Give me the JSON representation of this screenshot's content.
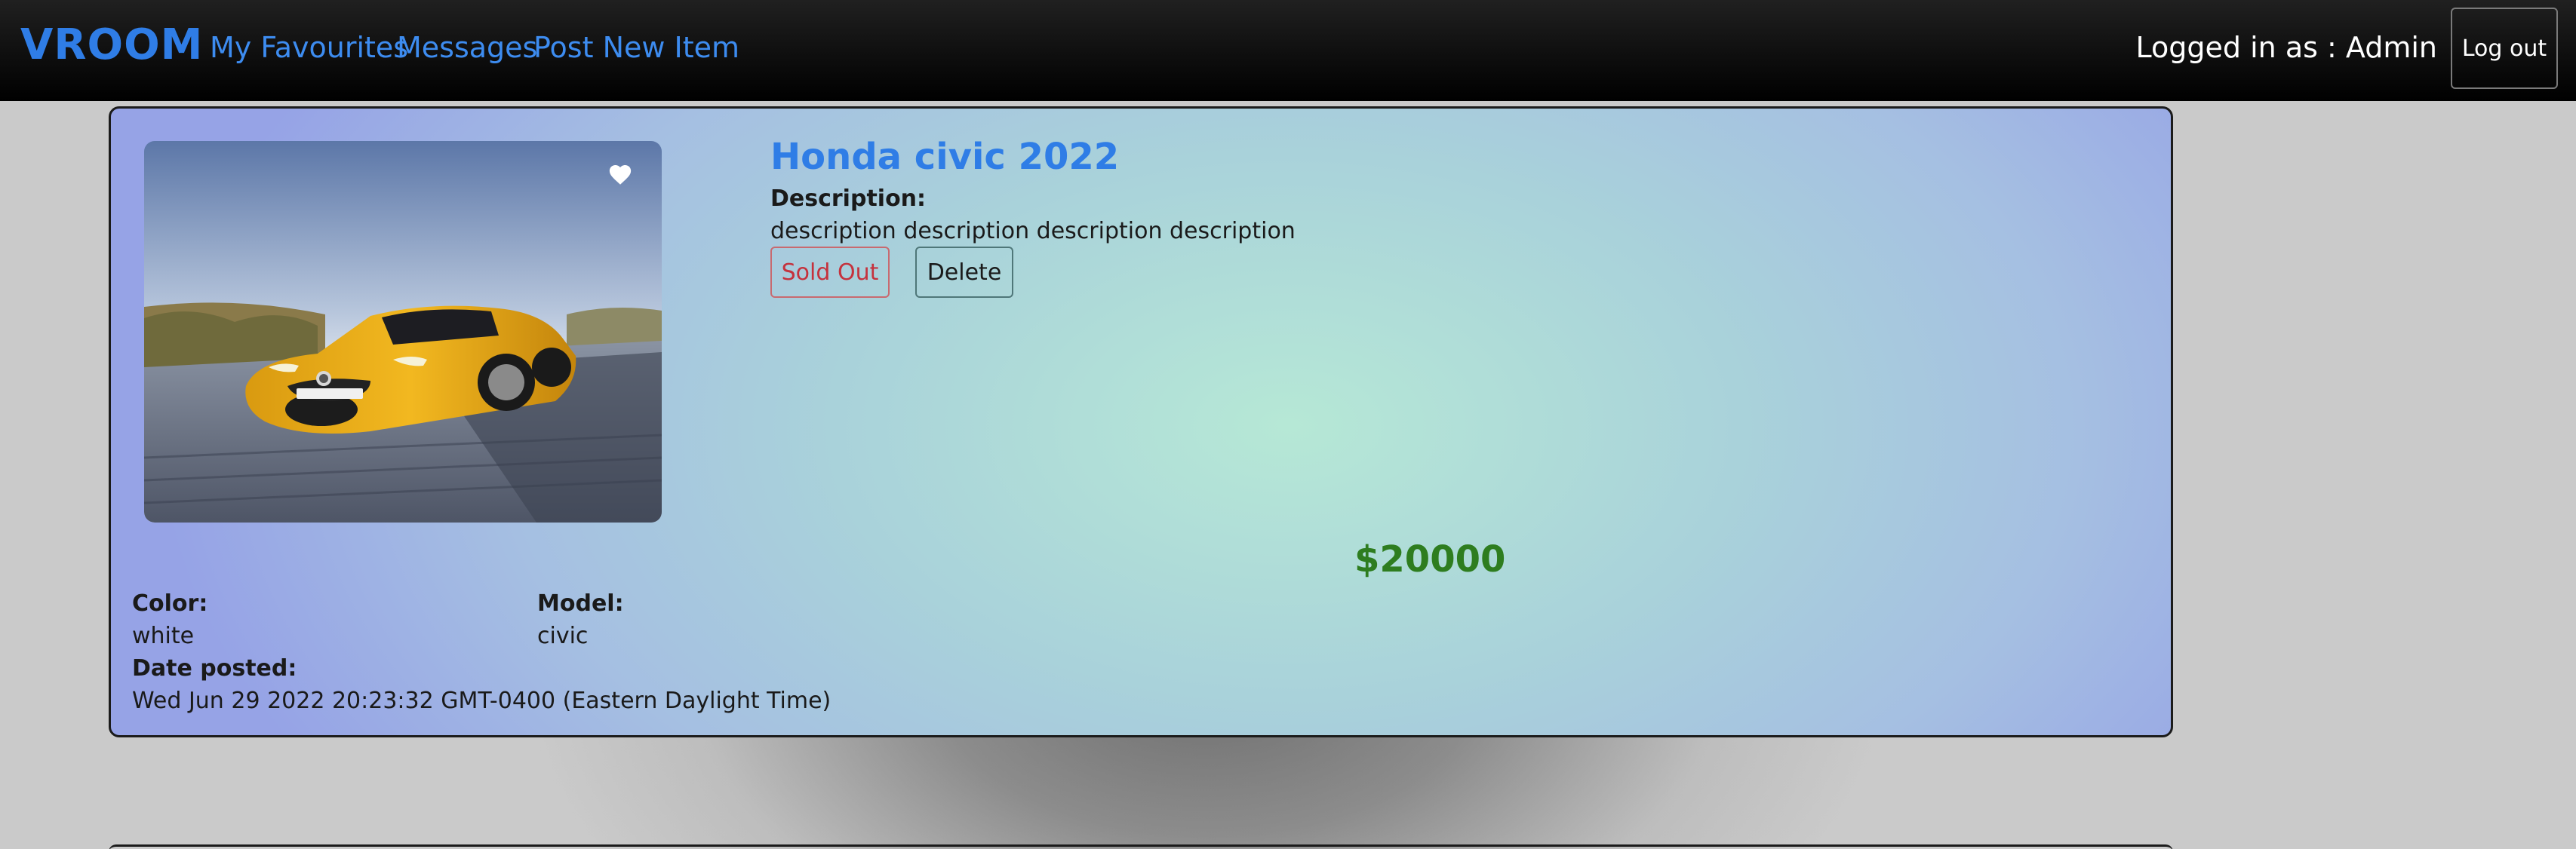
{
  "navbar": {
    "brand": "VROOM",
    "links": [
      "My Favourites",
      "Messages",
      "Post New Item"
    ],
    "logged_in_text": "Logged in as : Admin",
    "logout_label": "Log out"
  },
  "listing": {
    "title": "Honda civic 2022",
    "description_label": "Description:",
    "description": "description description description description",
    "sold_out_label": "Sold Out",
    "delete_label": "Delete",
    "price": "$20000",
    "color_label": "Color:",
    "color_value": "white",
    "model_label": "Model:",
    "model_value": "civic",
    "date_label": "Date posted:",
    "date_value": "Wed Jun 29 2022 20:23:32 GMT-0400 (Eastern Daylight Time)",
    "favourite_icon": "heart-icon",
    "image_subject": "yellow sports car"
  },
  "colors": {
    "brand": "#2f7de6",
    "price": "#2e7d1f",
    "sold_out": "#c5323d"
  }
}
